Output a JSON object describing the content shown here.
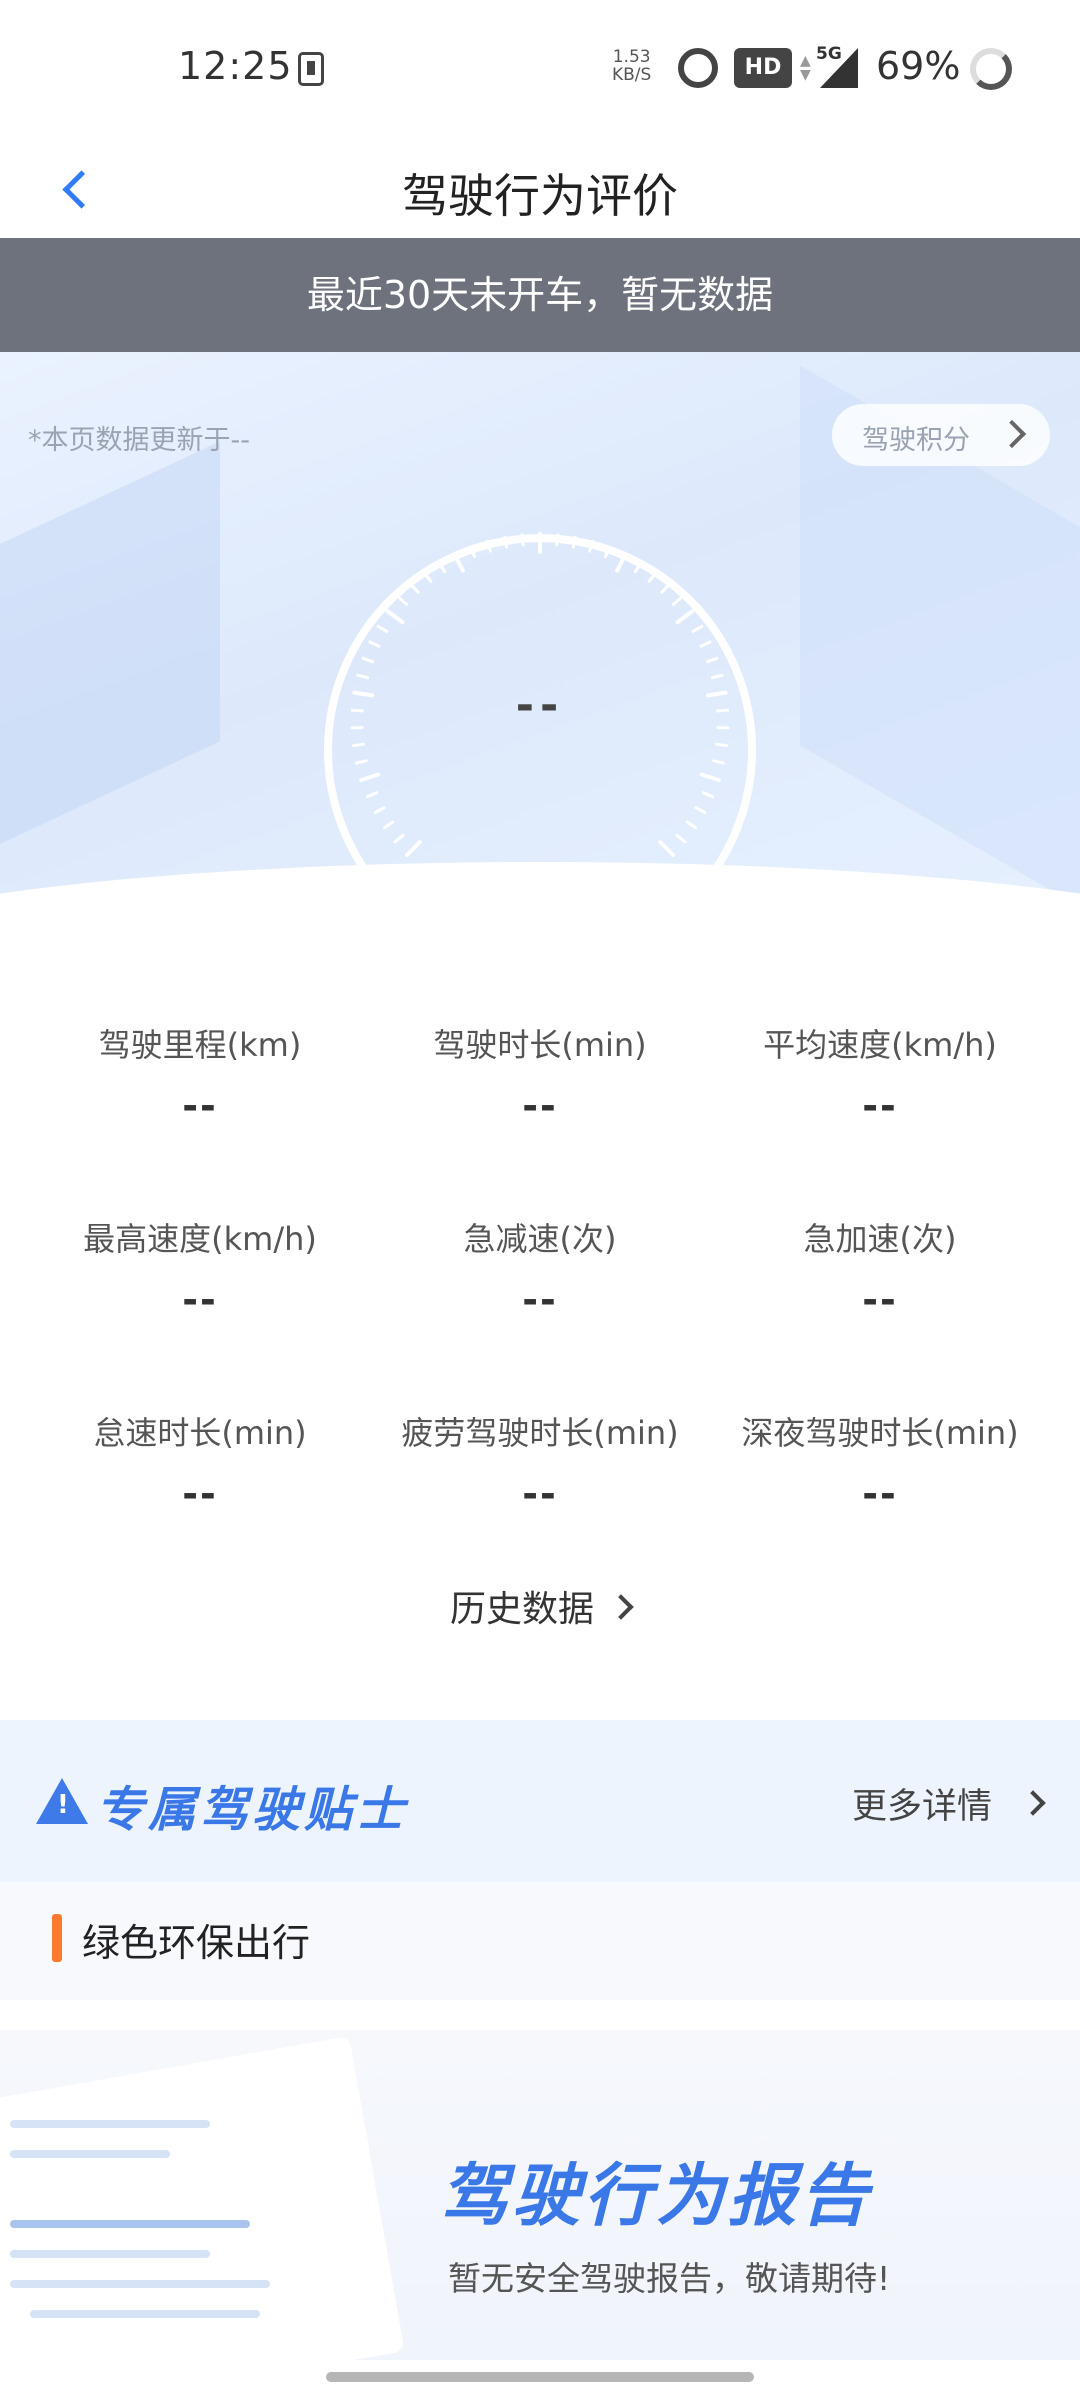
{
  "status_bar": {
    "time": "12:25",
    "net_speed_value": "1.53",
    "net_speed_unit": "KB/S",
    "hd": "HD",
    "network": "5G",
    "battery": "69%"
  },
  "nav": {
    "title": "驾驶行为评价"
  },
  "notice": {
    "text": "最近30天未开车，暂无数据"
  },
  "hero": {
    "update_text": "*本页数据更新于--",
    "score_link": "驾驶积分",
    "gauge_value": "--"
  },
  "stats": [
    {
      "label": "驾驶里程(km)",
      "value": "--"
    },
    {
      "label": "驾驶时长(min)",
      "value": "--"
    },
    {
      "label": "平均速度(km/h)",
      "value": "--"
    },
    {
      "label": "最高速度(km/h)",
      "value": "--"
    },
    {
      "label": "急减速(次)",
      "value": "--"
    },
    {
      "label": "急加速(次)",
      "value": "--"
    },
    {
      "label": "怠速时长(min)",
      "value": "--"
    },
    {
      "label": "疲劳驾驶时长(min)",
      "value": "--"
    },
    {
      "label": "深夜驾驶时长(min)",
      "value": "--"
    }
  ],
  "history": {
    "label": "历史数据"
  },
  "tips": {
    "title": "专属驾驶贴士",
    "more_label": "更多详情",
    "item": "绿色环保出行"
  },
  "report": {
    "title": "驾驶行为报告",
    "subtitle": "暂无安全驾驶报告，敬请期待!"
  },
  "colors": {
    "accent": "#2f7cf6",
    "notice_bg": "#6e727c",
    "tip_marker": "#ff7a2f",
    "gauge_dot": "#e84a4a"
  }
}
